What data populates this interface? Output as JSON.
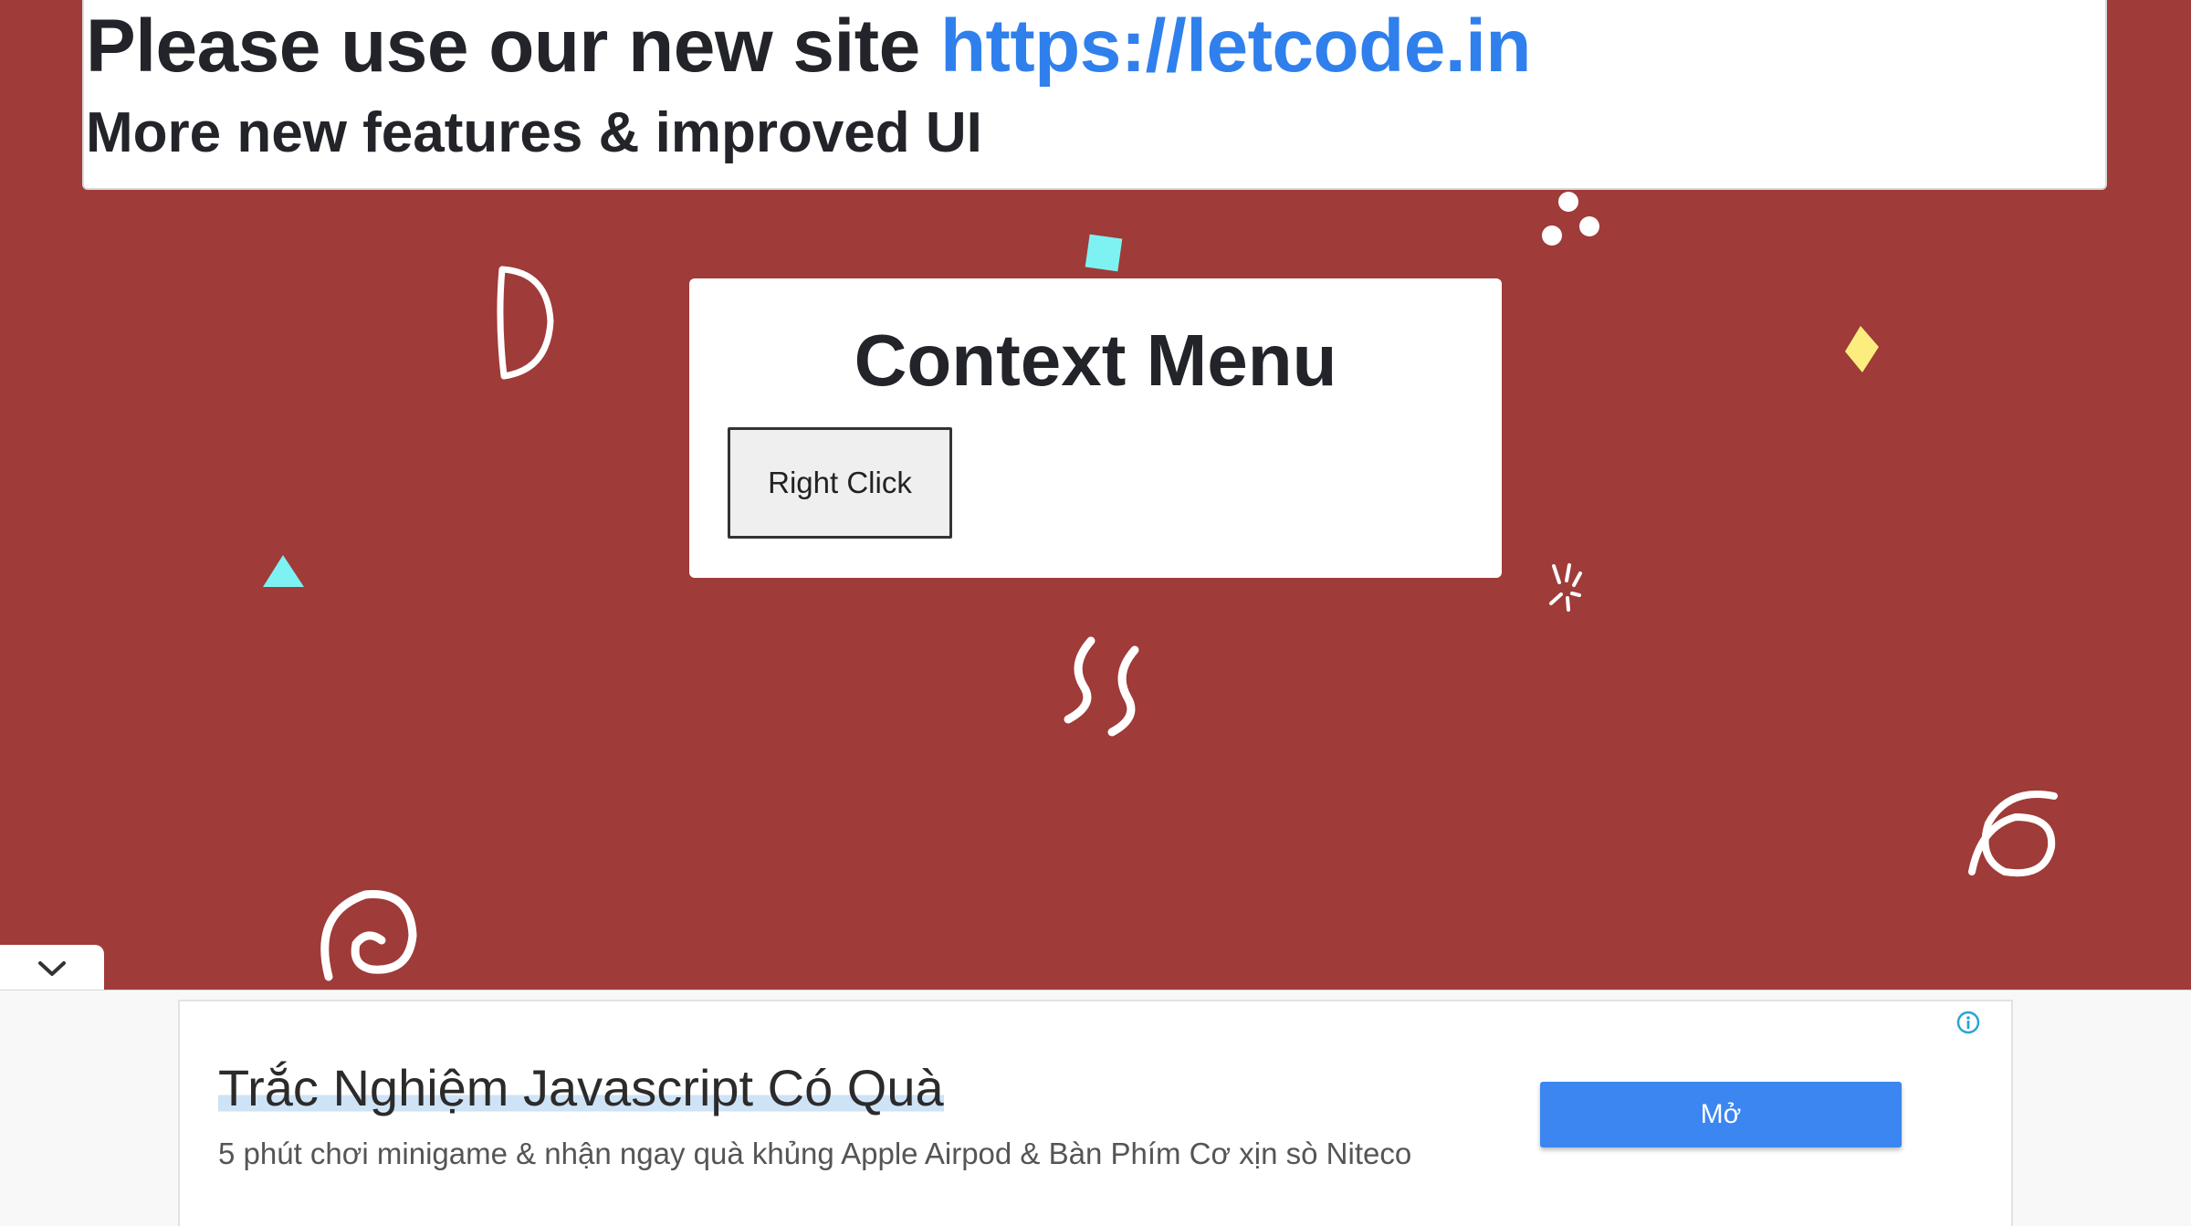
{
  "notice": {
    "line1_prefix": "Please use our new site ",
    "link_text": "https://letcode.in",
    "line2": "More new features & improved UI"
  },
  "card": {
    "title": "Context Menu",
    "button_label": "Right Click"
  },
  "ad": {
    "title": "Trắc Nghiệm Javascript Có Quà",
    "description": "5 phút chơi minigame & nhận ngay quà khủng Apple Airpod & Bàn Phím Cơ xịn sò Niteco",
    "open_button": "Mở",
    "info_icon": "info-icon"
  },
  "colors": {
    "background": "#9f3b38",
    "link": "#2f80ed",
    "ad_button": "#3b86f0",
    "confetti_cyan": "#7ef2f2",
    "confetti_yellow": "#fbee7f"
  },
  "icons": [
    "chevron-down-icon",
    "info-icon"
  ]
}
